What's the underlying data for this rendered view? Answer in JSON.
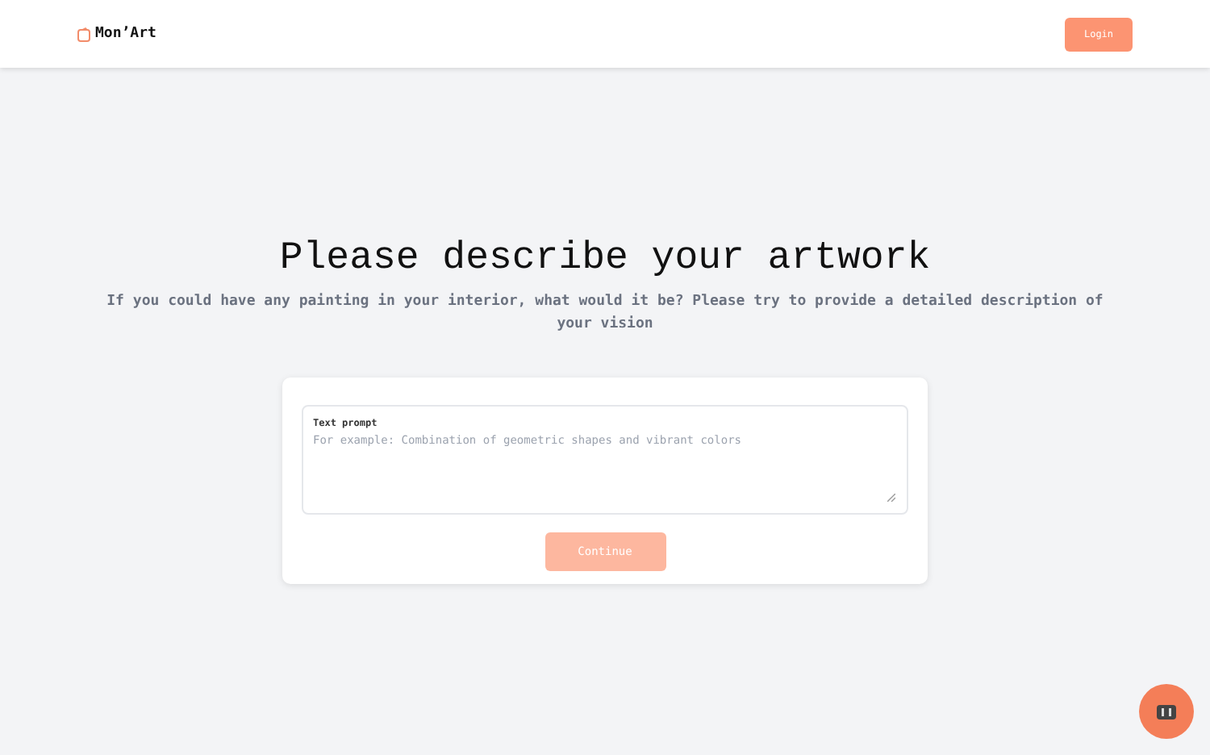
{
  "header": {
    "logo": "Mon’Art",
    "login_button": "Login"
  },
  "heading": "Please describe your artwork",
  "subheading": "If you could have any painting in your interior, what would it be? Please try to provide a detailed description of your vision",
  "prompt_field": {
    "label": "Text prompt",
    "placeholder": "For example: Combination of geometric shapes and vibrant colors"
  },
  "continue_button": {
    "label": "Continue",
    "disabled": true
  }
}
